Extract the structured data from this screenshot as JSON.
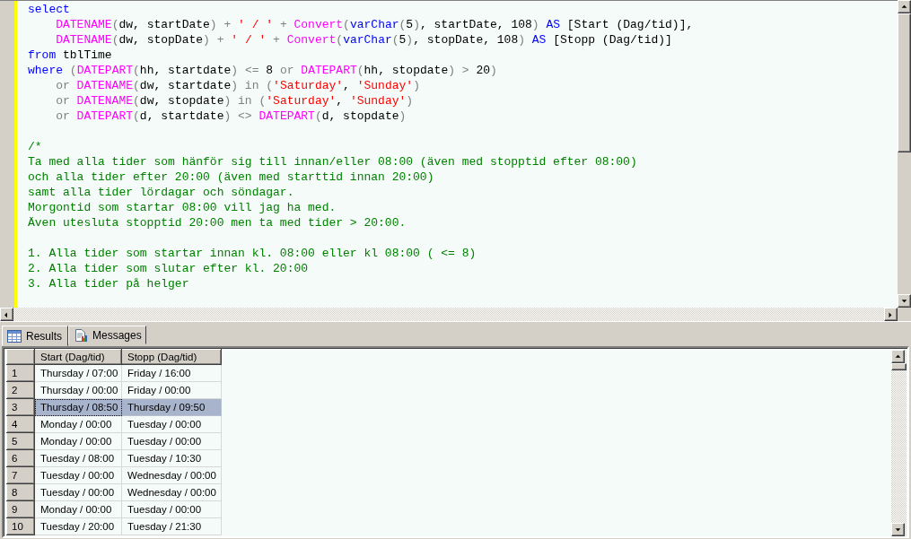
{
  "editor": {
    "lines": [
      {
        "tokens": [
          {
            "kind": "kw",
            "text": "select"
          }
        ]
      },
      {
        "indent": true,
        "tokens": [
          {
            "kind": "fn",
            "text": "DATENAME"
          },
          {
            "kind": "op",
            "text": "("
          },
          {
            "kind": "plain",
            "text": "dw, startDate"
          },
          {
            "kind": "op",
            "text": ") + "
          },
          {
            "kind": "str",
            "text": "' / '"
          },
          {
            "kind": "op",
            "text": " + "
          },
          {
            "kind": "fn",
            "text": "Convert"
          },
          {
            "kind": "op",
            "text": "("
          },
          {
            "kind": "kw",
            "text": "varChar"
          },
          {
            "kind": "op",
            "text": "("
          },
          {
            "kind": "plain",
            "text": "5"
          },
          {
            "kind": "op",
            "text": ")"
          },
          {
            "kind": "plain",
            "text": ", startDate, 108"
          },
          {
            "kind": "op",
            "text": ") "
          },
          {
            "kind": "kw",
            "text": "AS"
          },
          {
            "kind": "plain",
            "text": " [Start (Dag/tid)],"
          }
        ]
      },
      {
        "indent": true,
        "tokens": [
          {
            "kind": "fn",
            "text": "DATENAME"
          },
          {
            "kind": "op",
            "text": "("
          },
          {
            "kind": "plain",
            "text": "dw, stopDate"
          },
          {
            "kind": "op",
            "text": ") + "
          },
          {
            "kind": "str",
            "text": "' / '"
          },
          {
            "kind": "op",
            "text": " + "
          },
          {
            "kind": "fn",
            "text": "Convert"
          },
          {
            "kind": "op",
            "text": "("
          },
          {
            "kind": "kw",
            "text": "varChar"
          },
          {
            "kind": "op",
            "text": "("
          },
          {
            "kind": "plain",
            "text": "5"
          },
          {
            "kind": "op",
            "text": ")"
          },
          {
            "kind": "plain",
            "text": ", stopDate, 108"
          },
          {
            "kind": "op",
            "text": ") "
          },
          {
            "kind": "kw",
            "text": "AS"
          },
          {
            "kind": "plain",
            "text": " [Stopp (Dag/tid)]"
          }
        ]
      },
      {
        "tokens": [
          {
            "kind": "kw",
            "text": "from"
          },
          {
            "kind": "plain",
            "text": " tblTime"
          }
        ]
      },
      {
        "tokens": [
          {
            "kind": "kw",
            "text": "where"
          },
          {
            "kind": "op",
            "text": " ("
          },
          {
            "kind": "fn",
            "text": "DATEPART"
          },
          {
            "kind": "op",
            "text": "("
          },
          {
            "kind": "plain",
            "text": "hh, startdate"
          },
          {
            "kind": "op",
            "text": ") <= "
          },
          {
            "kind": "plain",
            "text": "8"
          },
          {
            "kind": "op",
            "text": " or "
          },
          {
            "kind": "fn",
            "text": "DATEPART"
          },
          {
            "kind": "op",
            "text": "("
          },
          {
            "kind": "plain",
            "text": "hh, stopdate"
          },
          {
            "kind": "op",
            "text": ") > "
          },
          {
            "kind": "plain",
            "text": "20"
          },
          {
            "kind": "op",
            "text": ")"
          }
        ]
      },
      {
        "indent": true,
        "tokens": [
          {
            "kind": "op",
            "text": "or "
          },
          {
            "kind": "fn",
            "text": "DATENAME"
          },
          {
            "kind": "op",
            "text": "("
          },
          {
            "kind": "plain",
            "text": "dw, startdate"
          },
          {
            "kind": "op",
            "text": ") in ("
          },
          {
            "kind": "str",
            "text": "'Saturday'"
          },
          {
            "kind": "plain",
            "text": ", "
          },
          {
            "kind": "str",
            "text": "'Sunday'"
          },
          {
            "kind": "op",
            "text": ")"
          }
        ]
      },
      {
        "indent": true,
        "tokens": [
          {
            "kind": "op",
            "text": "or "
          },
          {
            "kind": "fn",
            "text": "DATENAME"
          },
          {
            "kind": "op",
            "text": "("
          },
          {
            "kind": "plain",
            "text": "dw, stopdate"
          },
          {
            "kind": "op",
            "text": ") in ("
          },
          {
            "kind": "str",
            "text": "'Saturday'"
          },
          {
            "kind": "plain",
            "text": ", "
          },
          {
            "kind": "str",
            "text": "'Sunday'"
          },
          {
            "kind": "op",
            "text": ")"
          }
        ]
      },
      {
        "indent": true,
        "tokens": [
          {
            "kind": "op",
            "text": "or "
          },
          {
            "kind": "fn",
            "text": "DATEPART"
          },
          {
            "kind": "op",
            "text": "("
          },
          {
            "kind": "plain",
            "text": "d, startdate"
          },
          {
            "kind": "op",
            "text": ") <> "
          },
          {
            "kind": "fn",
            "text": "DATEPART"
          },
          {
            "kind": "op",
            "text": "("
          },
          {
            "kind": "plain",
            "text": "d, stopdate"
          },
          {
            "kind": "op",
            "text": ")"
          }
        ]
      },
      {
        "blank_line_before": true,
        "tokens": [
          {
            "kind": "comment",
            "text": "/*"
          }
        ]
      },
      {
        "tokens": [
          {
            "kind": "comment",
            "text": "Ta med alla tider som hänför sig till innan/eller 08:00 (även med stopptid efter 08:00)"
          }
        ]
      },
      {
        "tokens": [
          {
            "kind": "comment",
            "text": "och alla tider efter 20:00 (även med starttid innan 20:00)"
          }
        ]
      },
      {
        "tokens": [
          {
            "kind": "comment",
            "text": "samt alla tider lördagar och söndagar."
          }
        ]
      },
      {
        "tokens": [
          {
            "kind": "comment",
            "text": "Morgontid som startar 08:00 vill jag ha med."
          }
        ]
      },
      {
        "tokens": [
          {
            "kind": "comment",
            "text": "Även utesluta stopptid 20:00 men ta med tider > 20:00."
          }
        ]
      },
      {
        "blank_line_before": true,
        "tokens": [
          {
            "kind": "comment",
            "text": "1. Alla tider som startar innan kl. 08:00 eller kl 08:00 ( <= 8)"
          }
        ]
      },
      {
        "tokens": [
          {
            "kind": "comment",
            "text": "2. Alla tider som slutar efter kl. 20:00"
          }
        ]
      },
      {
        "tokens": [
          {
            "kind": "comment",
            "text": "3. Alla tider på helger"
          }
        ]
      }
    ]
  },
  "tabs": [
    {
      "label": "Results",
      "kind": "grid",
      "selected": true
    },
    {
      "label": "Messages",
      "kind": "messages",
      "selected": false
    }
  ],
  "grid": {
    "columns": [
      "Start (Dag/tid)",
      "Stopp (Dag/tid)"
    ],
    "rows": [
      {
        "number": "1",
        "cells": [
          "Thursday / 07:00",
          "Friday / 16:00"
        ],
        "selected": false
      },
      {
        "number": "2",
        "cells": [
          "Thursday / 00:00",
          "Friday / 00:00"
        ],
        "selected": false
      },
      {
        "number": "3",
        "cells": [
          "Thursday / 08:50",
          "Thursday / 09:50"
        ],
        "selected": true
      },
      {
        "number": "4",
        "cells": [
          "Monday / 00:00",
          "Tuesday / 00:00"
        ],
        "selected": false
      },
      {
        "number": "5",
        "cells": [
          "Monday / 00:00",
          "Tuesday / 00:00"
        ],
        "selected": false
      },
      {
        "number": "6",
        "cells": [
          "Tuesday / 08:00",
          "Tuesday / 10:30"
        ],
        "selected": false
      },
      {
        "number": "7",
        "cells": [
          "Tuesday / 00:00",
          "Wednesday / 00:00"
        ],
        "selected": false
      },
      {
        "number": "8",
        "cells": [
          "Tuesday / 00:00",
          "Wednesday / 00:00"
        ],
        "selected": false
      },
      {
        "number": "9",
        "cells": [
          "Monday / 00:00",
          "Tuesday / 00:00"
        ],
        "selected": false
      },
      {
        "number": "10",
        "cells": [
          "Tuesday / 20:00",
          "Tuesday / 21:30"
        ],
        "selected": false
      }
    ]
  }
}
